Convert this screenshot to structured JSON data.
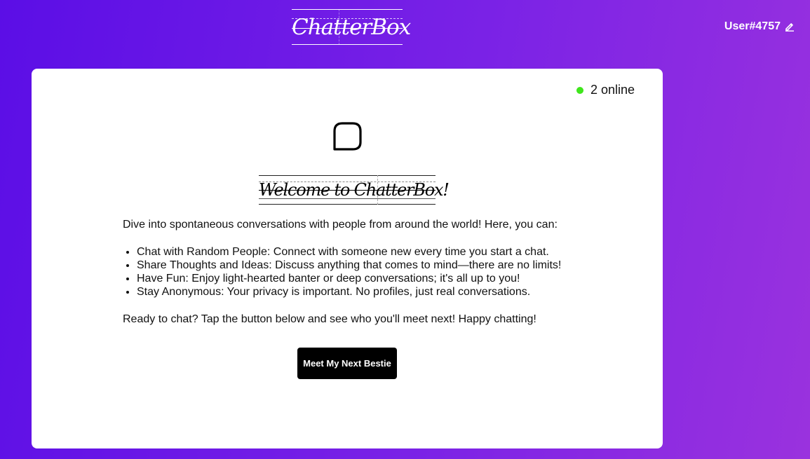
{
  "header": {
    "logo_text": "ChatterBox",
    "username": "User#4757",
    "edit_icon": "pencil-icon"
  },
  "status": {
    "online_label": "2 online",
    "indicator_color": "#3fe61c"
  },
  "main": {
    "chat_icon": "chat-bubble-icon",
    "welcome_heading": "Welcome to ChatterBox!",
    "intro": "Dive into spontaneous conversations with people from around the world! Here, you can:",
    "features": [
      "Chat with Random People: Connect with someone new every time you start a chat.",
      "Share Thoughts and Ideas: Discuss anything that comes to mind—there are no limits!",
      "Have Fun: Enjoy light-hearted banter or deep conversations; it's all up to you!",
      "Stay Anonymous: Your privacy is important. No profiles, just real conversations."
    ],
    "outro": "Ready to chat? Tap the button below and see who you'll meet next! Happy chatting!",
    "cta_label": "Meet My Next Bestie"
  },
  "colors": {
    "background_start": "#5b0ee6",
    "background_end": "#9a32de",
    "card": "#ffffff",
    "button": "#000000"
  }
}
